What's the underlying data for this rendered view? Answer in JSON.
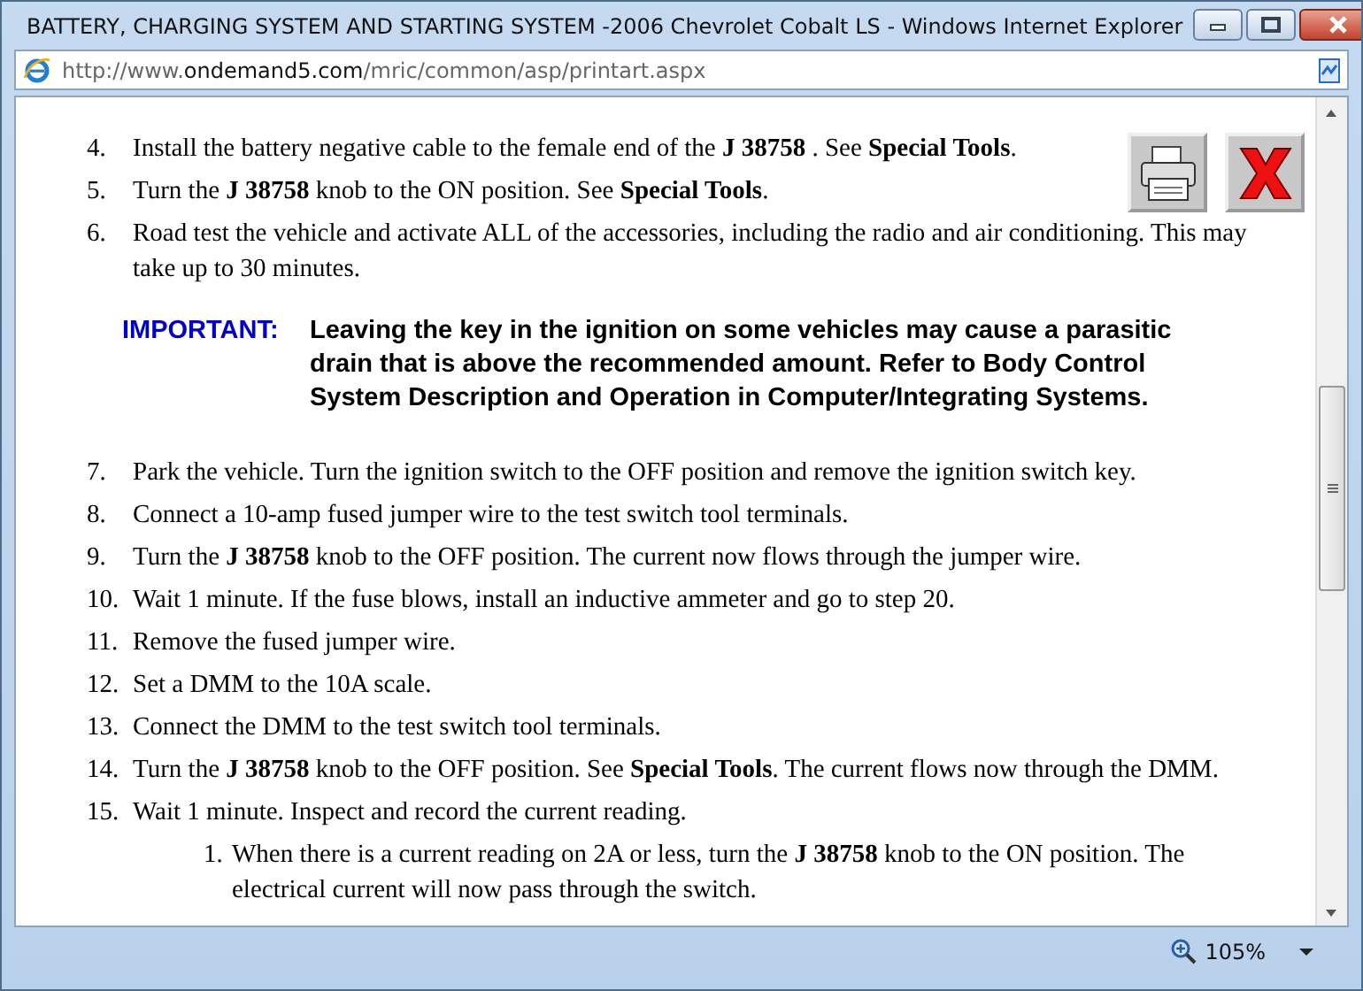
{
  "window": {
    "title": "BATTERY, CHARGING SYSTEM AND STARTING SYSTEM -2006 Chevrolet Cobalt LS - Windows Internet Explorer"
  },
  "address": {
    "prefix": "http://www.",
    "domain": "ondemand5.com",
    "path": "/mric/common/asp/printart.aspx"
  },
  "steps": [
    {
      "kind": "step",
      "number": "4.",
      "text": "Install the battery negative cable to the female end of the **J 38758** . See **Special Tools**."
    },
    {
      "kind": "step",
      "number": "5.",
      "text": "Turn the **J 38758** knob to the ON position. See **Special Tools**."
    },
    {
      "kind": "step",
      "number": "6.",
      "text": "Road test the vehicle and activate ALL of the accessories, including the radio and air conditioning. This may take up to 30 minutes."
    },
    {
      "kind": "note",
      "label": "IMPORTANT:",
      "text": "Leaving the key in the ignition on some vehicles may cause a parasitic drain that is above the recommended amount. Refer to Body Control System Description and Operation in Computer/Integrating Systems."
    },
    {
      "kind": "step",
      "number": "7.",
      "text": "Park the vehicle. Turn the ignition switch to the OFF position and remove the ignition switch key."
    },
    {
      "kind": "step",
      "number": "8.",
      "text": "Connect a 10-amp fused jumper wire to the test switch tool terminals."
    },
    {
      "kind": "step",
      "number": "9.",
      "text": "Turn the **J 38758** knob to the OFF position. The current now flows through the jumper wire."
    },
    {
      "kind": "step",
      "number": "10.",
      "text": "Wait 1 minute. If the fuse blows, install an inductive ammeter and go to step 20."
    },
    {
      "kind": "step",
      "number": "11.",
      "text": "Remove the fused jumper wire."
    },
    {
      "kind": "step",
      "number": "12.",
      "text": "Set a DMM to the 10A scale."
    },
    {
      "kind": "step",
      "number": "13.",
      "text": "Connect the DMM to the test switch tool terminals."
    },
    {
      "kind": "step",
      "number": "14.",
      "text": "Turn the **J 38758** knob to the OFF position. See **Special Tools**. The current flows now through the DMM."
    },
    {
      "kind": "step",
      "number": "15.",
      "text": "Wait 1 minute. Inspect and record the current reading.",
      "children": [
        {
          "number": "1.",
          "text": "When there is a current reading on 2A or less, turn the **J 38758** knob to the ON position. The electrical current will now pass through the switch."
        }
      ]
    }
  ],
  "status_bar": {
    "zoom": "105%"
  }
}
